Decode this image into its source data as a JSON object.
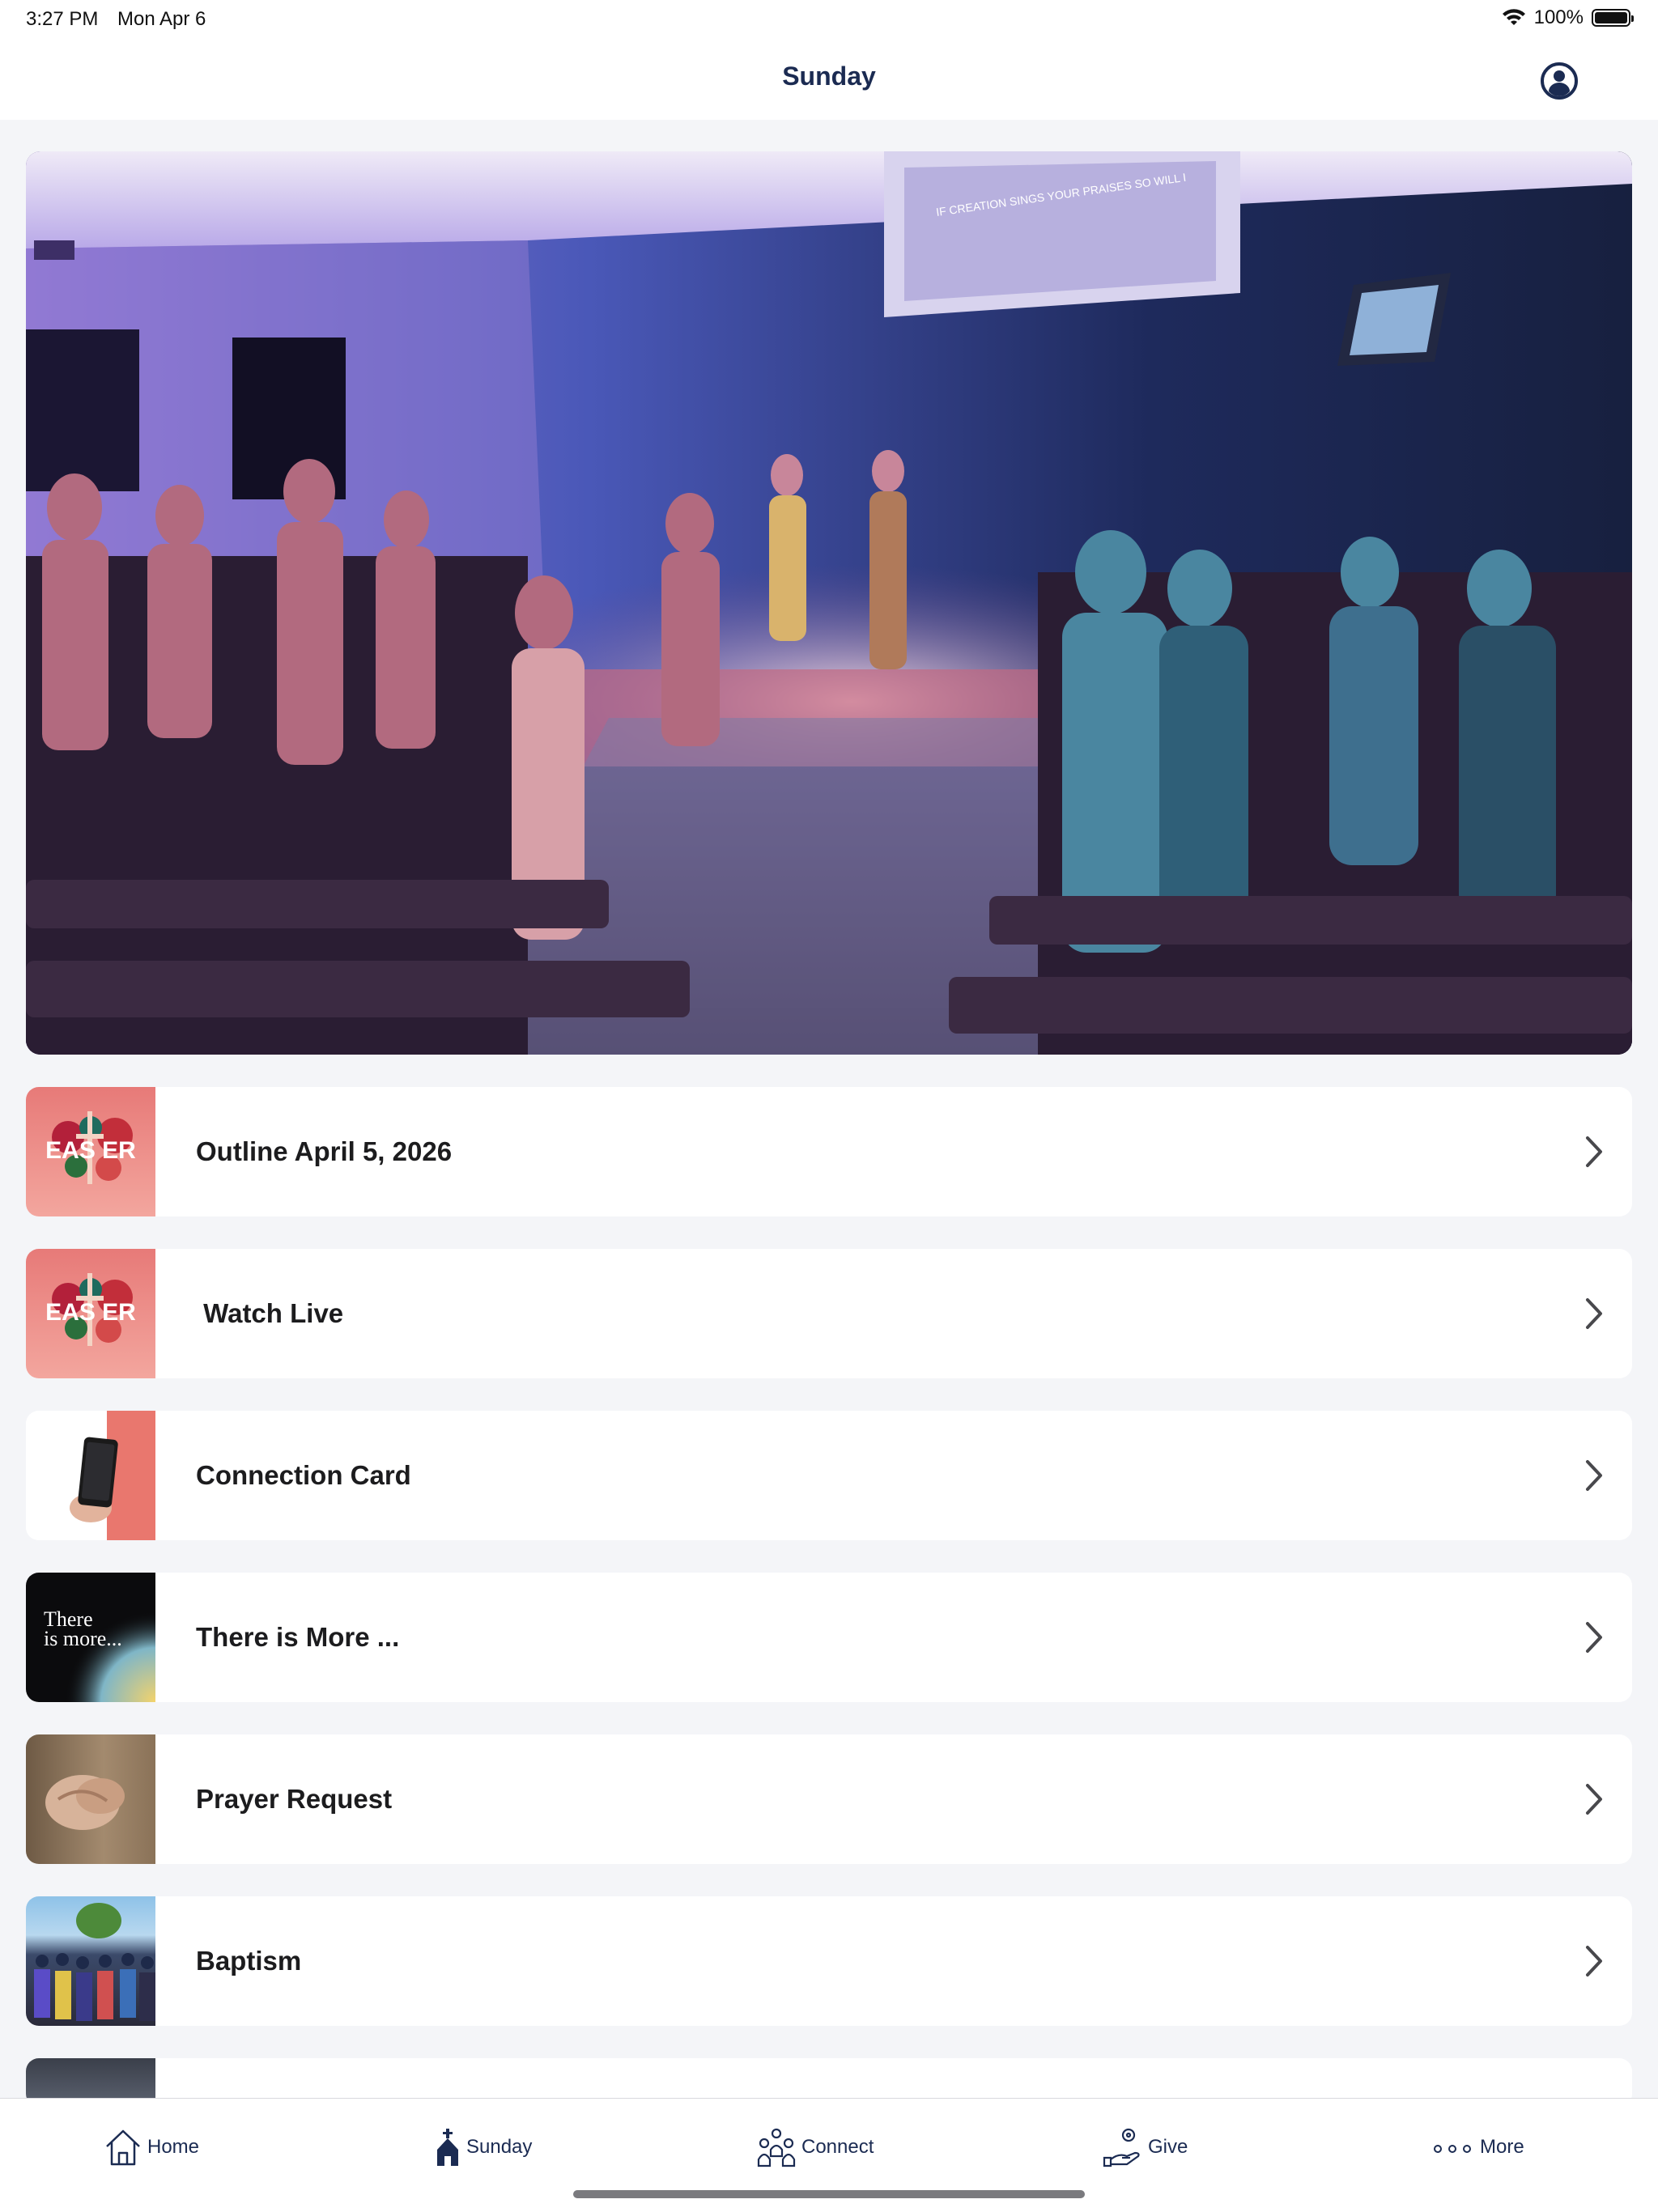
{
  "status_bar": {
    "time": "3:27 PM",
    "date": "Mon Apr 6",
    "battery": "100%"
  },
  "nav": {
    "title": "Sunday",
    "profile_icon": "person-circle-icon"
  },
  "hero": {
    "image": "worship-service-photo",
    "screen_text": "IF CREATION SINGS YOUR PRAISES SO WILL I"
  },
  "list": {
    "items": [
      {
        "label": "Outline April 5, 2026",
        "thumb": "easter-thumbnail",
        "thumb_text": "EAS ER"
      },
      {
        "label": " Watch Live",
        "thumb": "easter-thumbnail",
        "thumb_text": "EAS ER"
      },
      {
        "label": "Connection Card",
        "thumb": "phone-in-hand-thumbnail"
      },
      {
        "label": "There is More ...",
        "thumb": "there-is-more-thumbnail",
        "thumb_text_1": "There",
        "thumb_text_2": "is more..."
      },
      {
        "label": "Prayer Request",
        "thumb": "praying-hands-thumbnail"
      },
      {
        "label": "Baptism",
        "thumb": "baptism-crowd-thumbnail"
      }
    ]
  },
  "tab_bar": {
    "tabs": [
      {
        "label": "Home",
        "icon": "house-icon"
      },
      {
        "label": "Sunday",
        "icon": "church-icon"
      },
      {
        "label": "Connect",
        "icon": "people-icon"
      },
      {
        "label": "Give",
        "icon": "hand-coin-icon"
      },
      {
        "label": "More",
        "icon": "ellipsis-icon"
      }
    ]
  },
  "colors": {
    "accent": "#1b2b52",
    "background": "#f4f5f8",
    "card": "#ffffff"
  }
}
